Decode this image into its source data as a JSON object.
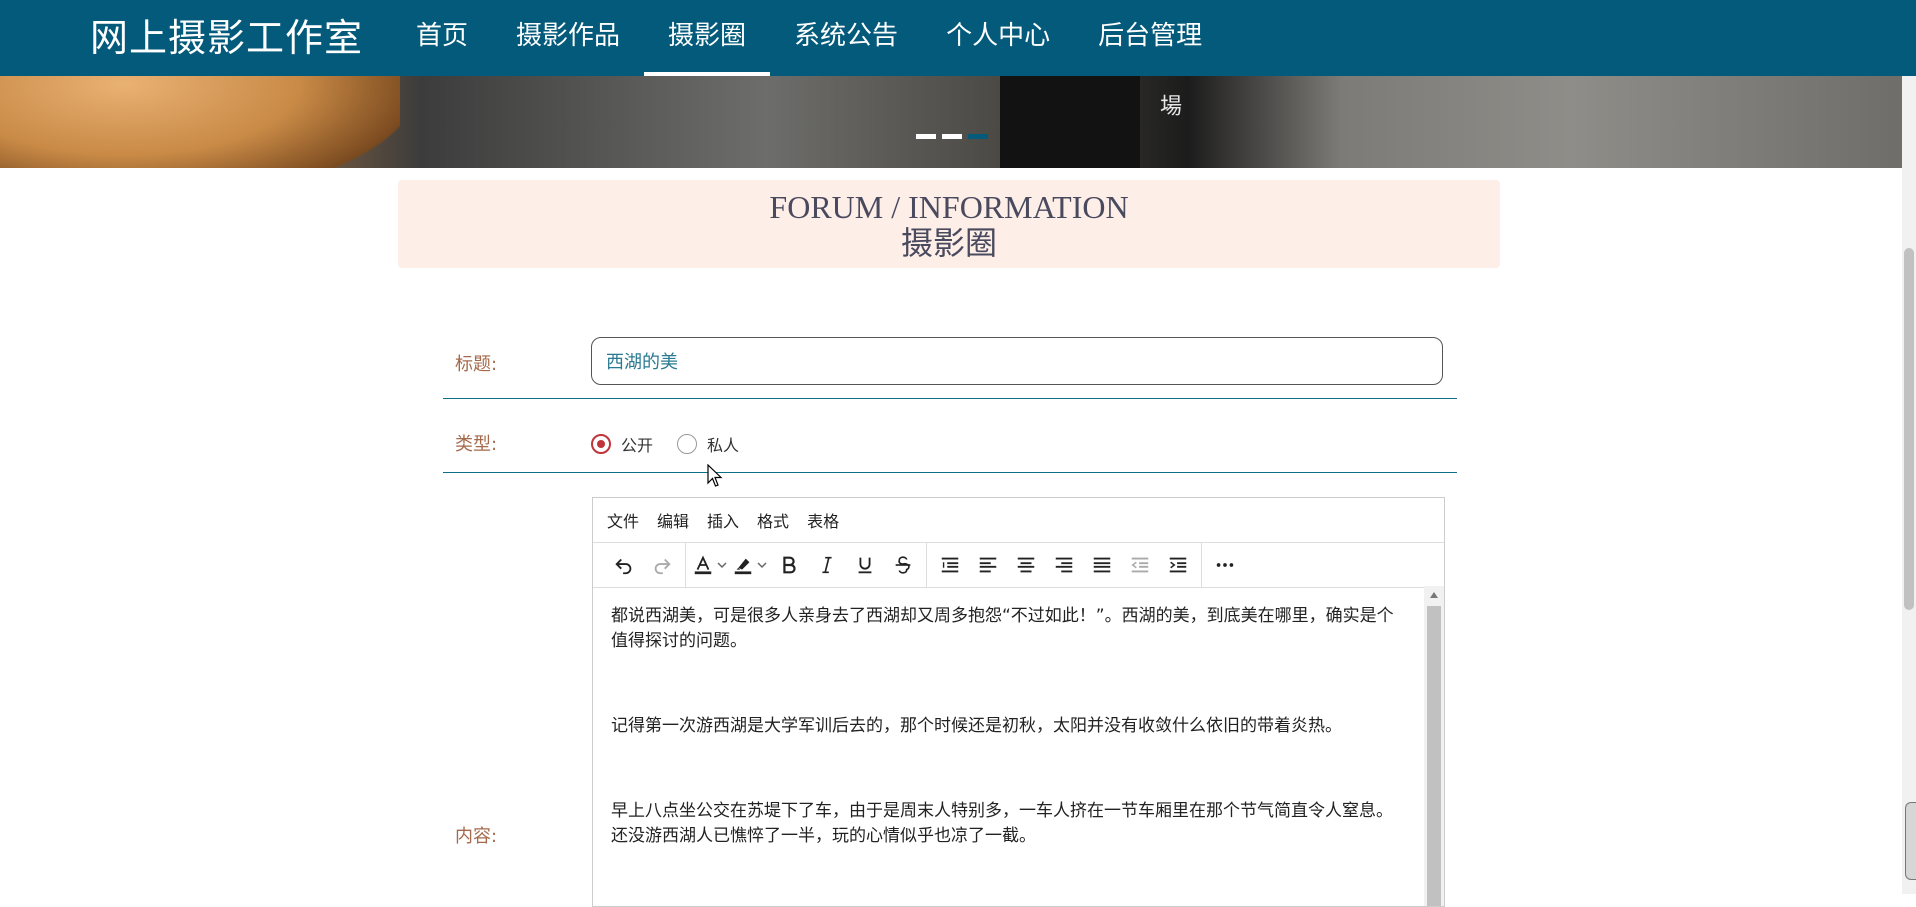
{
  "brand": {
    "title": "网上摄影工作室"
  },
  "nav": {
    "items": [
      {
        "label": "首页",
        "active": false
      },
      {
        "label": "摄影作品",
        "active": false
      },
      {
        "label": "摄影圈",
        "active": true
      },
      {
        "label": "系统公告",
        "active": false
      },
      {
        "label": "个人中心",
        "active": false
      },
      {
        "label": "后台管理",
        "active": false
      }
    ]
  },
  "banner": {
    "overlay_text": "場"
  },
  "section": {
    "title_en": "FORUM / INFORMATION",
    "title_cn": "摄影圈"
  },
  "form": {
    "title_label": "标题:",
    "title_value": "西湖的美",
    "type_label": "类型:",
    "type_options": [
      {
        "label": "公开",
        "checked": true
      },
      {
        "label": "私人",
        "checked": false
      }
    ],
    "content_label": "内容:"
  },
  "editor": {
    "menu": [
      "文件",
      "编辑",
      "插入",
      "格式",
      "表格"
    ],
    "toolbar_icons": [
      "undo-icon",
      "redo-icon",
      "text-color-icon",
      "highlight-icon",
      "bold-icon",
      "italic-icon",
      "underline-icon",
      "strikethrough-icon",
      "line-height-icon",
      "align-left-icon",
      "align-center-icon",
      "align-right-icon",
      "align-justify-icon",
      "outdent-icon",
      "indent-icon",
      "more-icon"
    ],
    "paragraphs": [
      "都说西湖美，可是很多人亲身去了西湖却又周多抱怨“不过如此！”。西湖的美，到底美在哪里，确实是个值得探讨的问题。",
      "记得第一次游西湖是大学军训后去的，那个时候还是初秋，太阳并没有收敛什么依旧的带着炎热。",
      "早上八点坐公交在苏堤下了车，由于是周末人特别多，一车人挤在一节车厢里在那个节气简直令人窒息。还没游西湖人已憔悴了一半，玩的心情似乎也凉了一截。"
    ]
  },
  "colors": {
    "nav_bg": "#045a7b",
    "section_bg": "#fdeee8",
    "radio_checked": "#c0353b",
    "label": "#a56a4c"
  }
}
